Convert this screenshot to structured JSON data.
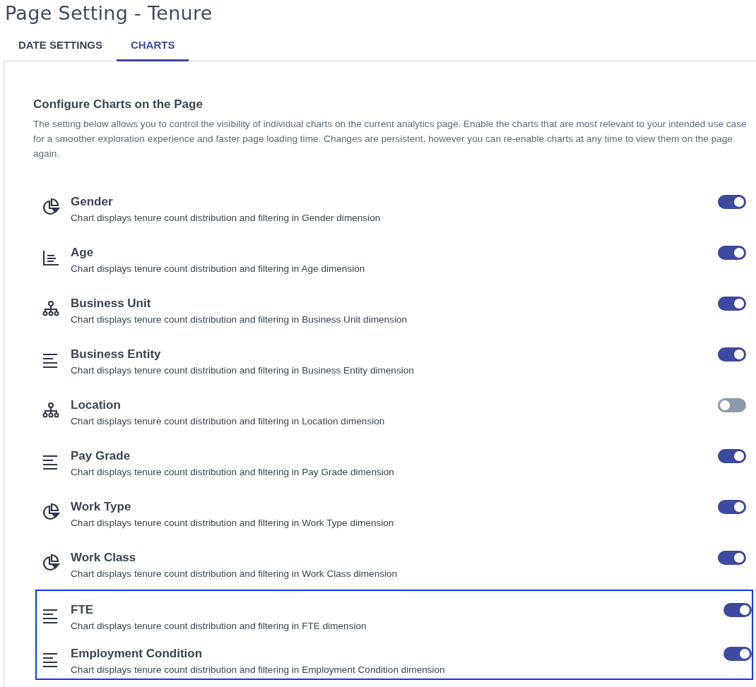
{
  "page_title": "Page Setting - Tenure",
  "tabs": [
    {
      "label": "DATE SETTINGS",
      "selected": false
    },
    {
      "label": "CHARTS",
      "selected": true
    }
  ],
  "section": {
    "heading": "Configure Charts on the Page",
    "description": "The setting below allows you to control the visibility of individual charts on the current analytics page. Enable the charts that are most relevant to your intended use case for a smoother exploration experience and faster page loading time. Changes are persistent, however you can re-enable charts at any time to view them on the page again."
  },
  "charts": [
    {
      "kind": "pie",
      "name": "Gender",
      "description": "Chart displays tenure count distribution and filtering in Gender dimension",
      "on": true,
      "highlighted": false
    },
    {
      "kind": "column",
      "name": "Age",
      "description": "Chart displays tenure count distribution and filtering in Age dimension",
      "on": true,
      "highlighted": false
    },
    {
      "kind": "hierarchy",
      "name": "Business Unit",
      "description": "Chart displays tenure count distribution and filtering in Business Unit dimension",
      "on": true,
      "highlighted": false
    },
    {
      "kind": "list",
      "name": "Business Entity",
      "description": "Chart displays tenure count distribution and filtering in Business Entity dimension",
      "on": true,
      "highlighted": false
    },
    {
      "kind": "hierarchy",
      "name": "Location",
      "description": "Chart displays tenure count distribution and filtering in Location dimension",
      "on": false,
      "highlighted": false
    },
    {
      "kind": "list",
      "name": "Pay Grade",
      "description": "Chart displays tenure count distribution and filtering in Pay Grade dimension",
      "on": true,
      "highlighted": false
    },
    {
      "kind": "pie",
      "name": "Work Type",
      "description": "Chart displays tenure count distribution and filtering in Work Type dimension",
      "on": true,
      "highlighted": false
    },
    {
      "kind": "pie",
      "name": "Work Class",
      "description": "Chart displays tenure count distribution and filtering in Work Class dimension",
      "on": true,
      "highlighted": false
    },
    {
      "kind": "list",
      "name": "FTE",
      "description": "Chart displays tenure count distribution and filtering in FTE dimension",
      "on": true,
      "highlighted": true
    },
    {
      "kind": "list",
      "name": "Employment Condition",
      "description": "Chart displays tenure count distribution and filtering in Employment Condition dimension",
      "on": true,
      "highlighted": true
    }
  ]
}
